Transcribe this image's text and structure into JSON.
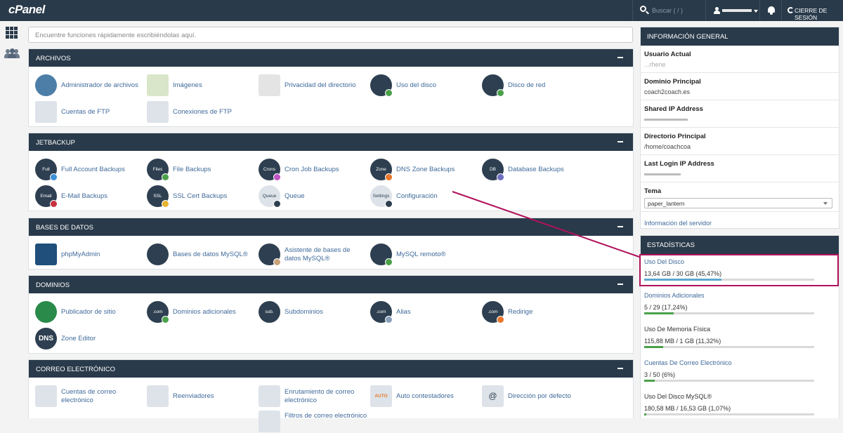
{
  "topbar": {
    "logo": "cPanel",
    "search_placeholder": "Buscar ( / )",
    "logout_label": "CIERRE DE SESIÓN"
  },
  "search": {
    "placeholder": "Encuentre funciones rápidamente escribiéndolas aquí."
  },
  "sections": {
    "archivos": {
      "title": "ARCHIVOS",
      "items": [
        "Administrador de archivos",
        "Imágenes",
        "Privacidad del directorio",
        "Uso del disco",
        "Disco de red",
        "Cuentas de FTP",
        "Conexiones de FTP"
      ]
    },
    "jetbackup": {
      "title": "JETBACKUP",
      "items": [
        "Full Account Backups",
        "File Backups",
        "Cron Job Backups",
        "DNS Zone Backups",
        "Database Backups",
        "E-Mail Backups",
        "SSL Cert Backups",
        "Queue",
        "Configuración"
      ],
      "icon_texts": [
        "Full",
        "Files",
        "Crons",
        "Zone",
        "DB",
        "Email",
        "SSL",
        "Queue",
        "Settings"
      ]
    },
    "bases": {
      "title": "BASES DE DATOS",
      "items": [
        "phpMyAdmin",
        "Bases de datos MySQL®",
        "Asistente de bases de datos MySQL®",
        "MySQL remoto®"
      ]
    },
    "dominios": {
      "title": "DOMINIOS",
      "items": [
        "Publicador de sitio",
        "Dominios adicionales",
        "Subdominios",
        "Alias",
        "Redirige",
        "Zone Editor"
      ],
      "icon_texts": [
        ".com",
        "sub.",
        ".com",
        ".com",
        "DNS"
      ]
    },
    "correo": {
      "title": "CORREO ELECTRÓNICO",
      "items": [
        "Cuentas de correo electrónico",
        "Reenviadores",
        "Enrutamiento de correo electrónico",
        "Auto contestadores",
        "Dirección por defecto",
        "Filtros de correo electrónico"
      ],
      "icon_texts": [
        "AUTO",
        "@"
      ]
    }
  },
  "info": {
    "title": "INFORMACIÓN GENERAL",
    "rows": [
      {
        "k": "Usuario Actual",
        "v": "...rhene"
      },
      {
        "k": "Dominio Principal",
        "v": "coach2coach.es"
      },
      {
        "k": "Shared IP Address",
        "v": ""
      },
      {
        "k": "Directorio Principal",
        "v": "/home/coachcoa"
      },
      {
        "k": "Last Login IP Address",
        "v": ""
      }
    ],
    "theme_label": "Tema",
    "theme_value": "paper_lantern",
    "server_link": "Información del servidor"
  },
  "stats": {
    "title": "ESTADÍSTICAS",
    "items": [
      {
        "label": "Uso Del Disco",
        "value": "13,64 GB / 30 GB   (45,47%)",
        "percent": 45.47,
        "color": "#5ea8d0",
        "link": true
      },
      {
        "label": "Dominios Adicionales",
        "value": "5 / 29   (17,24%)",
        "percent": 17.24,
        "color": "#4aa14a",
        "link": true
      },
      {
        "label": "Uso De Memoria Física",
        "value": "115,88 MB / 1 GB   (11,32%)",
        "percent": 11.32,
        "color": "#4aa14a",
        "link": false
      },
      {
        "label": "Cuentas De Correo Electrónico",
        "value": "3 / 50   (6%)",
        "percent": 6,
        "color": "#4aa14a",
        "link": true
      },
      {
        "label": "Uso Del Disco MySQL®",
        "value": "180,58 MB / 16,53 GB   (1,07%)",
        "percent": 1.07,
        "color": "#4aa14a",
        "link": false
      }
    ]
  },
  "colors": {
    "header": "#293a4a",
    "link": "#3f6a9a",
    "highlight": "#b0125b"
  }
}
